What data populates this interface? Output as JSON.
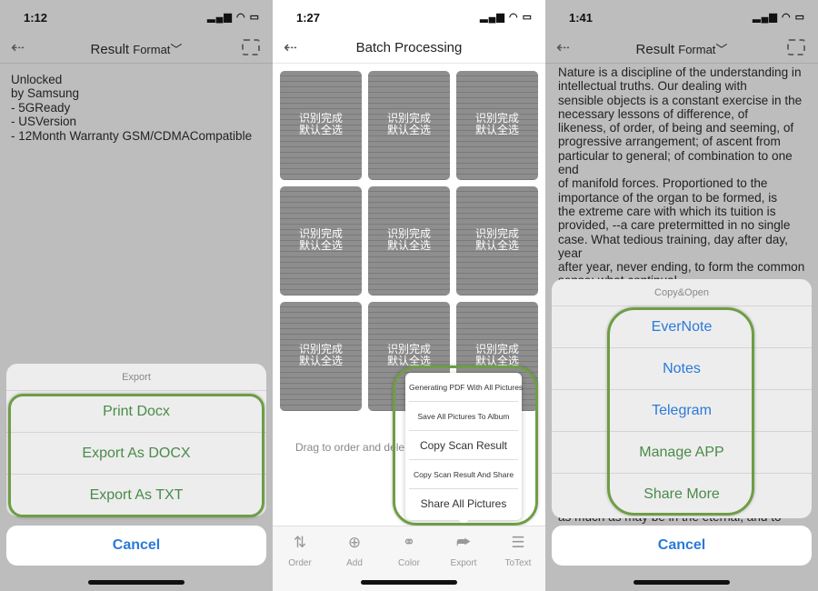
{
  "panel1": {
    "time": "1:12",
    "nav": {
      "title": "Result",
      "format": "Format",
      "chevron": "chevron-down-icon"
    },
    "text": "Unlocked\nby Samsung\n- 5GReady\n- USVersion\n- 12Month Warranty GSM/CDMACompatible",
    "sheet": {
      "title": "Export",
      "items": [
        "Print Docx",
        "Export As DOCX",
        "Export As TXT"
      ]
    },
    "cancel": "Cancel"
  },
  "panel2": {
    "time": "1:27",
    "title": "Batch Processing",
    "thumb_overlay": "识别完成\n默认全选",
    "drag_hint": "Drag to order and dele",
    "menu": [
      "Generating PDF With All Pictures",
      "Save All Pictures To Album",
      "Copy Scan Result",
      "Copy Scan Result And Share",
      "Share All Pictures"
    ],
    "toolbar": [
      {
        "label": "Order",
        "icon": "sort-icon"
      },
      {
        "label": "Add",
        "icon": "plus-circle-icon"
      },
      {
        "label": "Color",
        "icon": "color-circles-icon"
      },
      {
        "label": "Export",
        "icon": "share-icon"
      },
      {
        "label": "ToText",
        "icon": "lines-icon"
      }
    ]
  },
  "panel3": {
    "time": "1:41",
    "nav": {
      "title": "Result",
      "format": "Format"
    },
    "text": " Nature is a discipline of the understanding in\nintellectual truths. Our dealing with\n sensible objects is a constant exercise in the\nnecessary lessons of difference, of\n likeness, of order, of being and seeming, of\nprogressive arrangement; of ascent from\nparticular to general; of combination to one end\nof manifold forces. Proportioned to the\nimportance of the organ to be formed, is\n the extreme care with which its tuition is\n provided, --a care pretermitted in no single\ncase. What tedious training, day after day, year\nafter year, never ending, to form the common\nsense; what continual\n reproduction of annoyances,",
    "text_bottom": "as much as may be in the eternal, and to",
    "sheet": {
      "title": "Copy&Open",
      "items": [
        "EverNote",
        "Notes",
        "Telegram",
        "Manage APP",
        "Share More"
      ]
    },
    "cancel": "Cancel"
  },
  "colors": {
    "highlight": "#6d9e45",
    "link_blue": "#2a7ad8",
    "green_text": "#4a8a4a"
  }
}
